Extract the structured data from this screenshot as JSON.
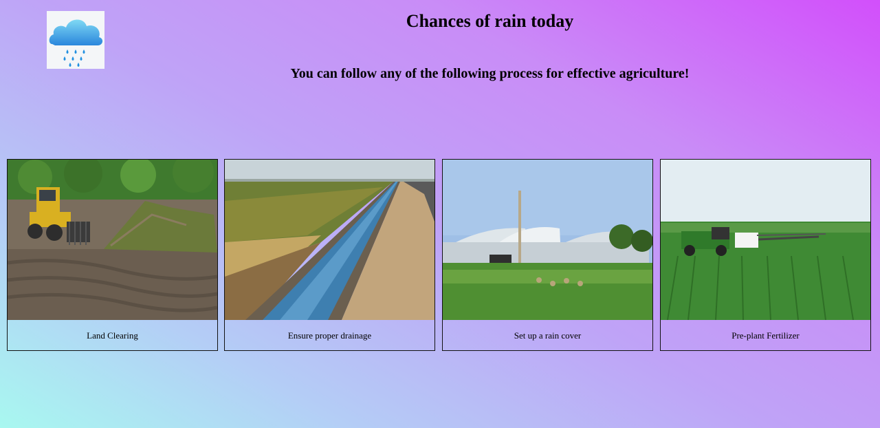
{
  "header": {
    "title": "Chances of rain today",
    "subtitle": "You can follow any of the following process for effective agriculture!"
  },
  "logo": {
    "icon": "rain-cloud-icon",
    "colors": {
      "cloud_top": "#6ad1f2",
      "cloud_bottom": "#2c8ee0",
      "drops": "#1f8fe0"
    }
  },
  "cards": [
    {
      "caption": "Land Clearing",
      "image": "bulldozer-clearing-land"
    },
    {
      "caption": "Ensure proper drainage",
      "image": "irrigation-canal"
    },
    {
      "caption": "Set up a rain cover",
      "image": "greenhouse-rain-cover"
    },
    {
      "caption": "Pre-plant Fertilizer",
      "image": "tractor-spraying-field"
    }
  ]
}
